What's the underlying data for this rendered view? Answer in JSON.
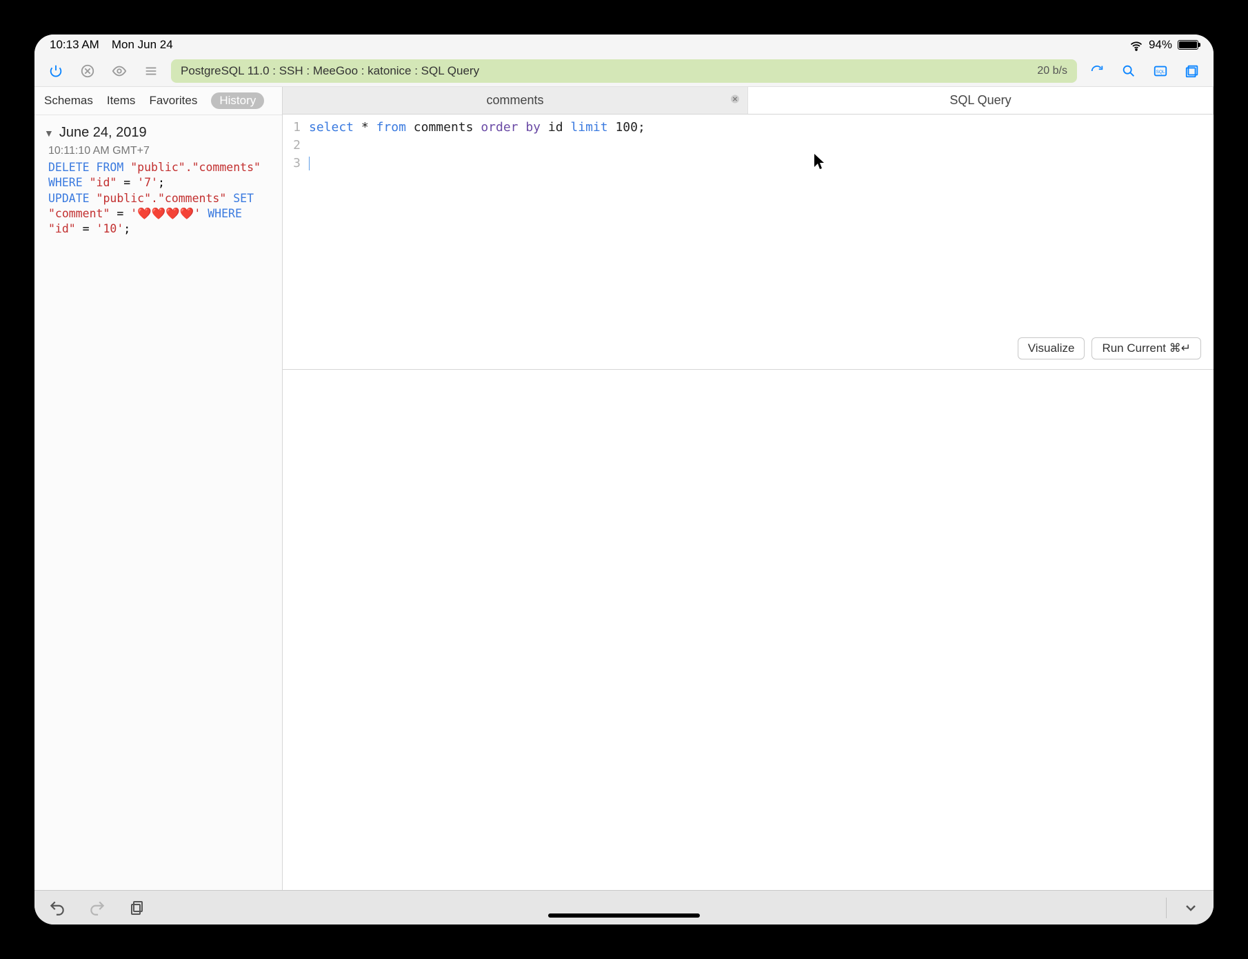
{
  "statusbar": {
    "time": "10:13 AM",
    "date": "Mon Jun 24",
    "battery_pct": "94%"
  },
  "toolbar": {
    "address": "PostgreSQL 11.0 : SSH : MeeGoo : katonice : SQL Query",
    "rate": "20 b/s"
  },
  "sidebar": {
    "tabs": [
      "Schemas",
      "Items",
      "Favorites",
      "History"
    ],
    "active_tab": "History",
    "section_date": "June 24, 2019",
    "entry_time": "10:11:10 AM GMT+7",
    "history_sql": {
      "delete_kw": "DELETE FROM ",
      "delete_tbl": "\"public\".\"comments\"",
      "where1_kw": "WHERE ",
      "where1_col": "\"id\" ",
      "where1_eq": "= ",
      "where1_val": "'7'",
      "where1_end": ";",
      "update_kw": "UPDATE ",
      "update_tbl": "\"public\".\"comments\" ",
      "set_kw": "SET",
      "set_col": "\"comment\" ",
      "set_eq": "= ",
      "set_val": "'❤️❤️❤️❤️' ",
      "where2_kw": "WHERE",
      "where2_col": "\"id\" ",
      "where2_eq": "= ",
      "where2_val": "'10'",
      "where2_end": ";"
    }
  },
  "tabs": [
    {
      "label": "comments",
      "closable": true,
      "active": false
    },
    {
      "label": "SQL Query",
      "closable": false,
      "active": true
    }
  ],
  "editor": {
    "lines": [
      "1",
      "2",
      "3"
    ],
    "tokens": {
      "select": "select",
      "star": "*",
      "from": "from",
      "table": "comments",
      "order": "order",
      "by": "by",
      "id": "id",
      "limit": "limit",
      "num": "100",
      "semi": ";"
    }
  },
  "buttons": {
    "visualize": "Visualize",
    "run": "Run Current ⌘↵"
  }
}
